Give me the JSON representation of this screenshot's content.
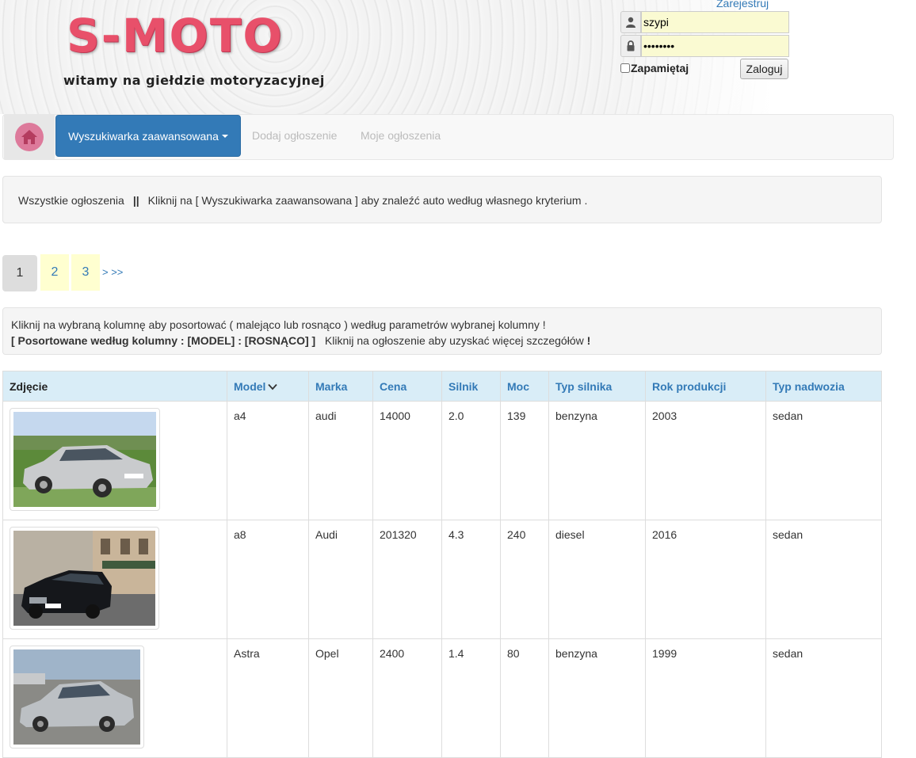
{
  "header": {
    "logo_title": "S-MOTO",
    "logo_subtitle": "witamy na giełdzie motoryzacyjnej",
    "register_link": "Zarejestruj",
    "username_value": "szypi",
    "password_value": "••••••••",
    "remember_label": "Zapamiętaj",
    "login_button": "Zaloguj"
  },
  "nav": {
    "home_icon": "home-icon",
    "search_dropdown": "Wyszukiwarka zaawansowana",
    "add_ad": "Dodaj ogłoszenie",
    "my_ads": "Moje ogłoszenia"
  },
  "info": {
    "all_ads": "Wszystkie ogłoszenia",
    "separator": "||",
    "hint": "Kliknij na [ Wyszukiwarka zaawansowana ] aby znaleźć auto według własnego kryterium ."
  },
  "pagination": {
    "current": "1",
    "pages": [
      "2",
      "3"
    ],
    "next": "> >>"
  },
  "sort_info": {
    "line1": "Kliknij na wybraną kolumnę aby posortować ( malejąco lub rosnąco ) według parametrów wybranej kolumny !",
    "sorted_label": "[ Posortowane według kolumny :  [MODEL] :  [ROSNĄCO] ]",
    "click_hint": "Kliknij na ogłoszenie aby uzyskać więcej szczegółów",
    "click_hint_end": "!"
  },
  "table": {
    "headers": [
      "Zdjęcie",
      "Model",
      "Marka",
      "Cena",
      "Silnik",
      "Moc",
      "Typ silnika",
      "Rok produkcji",
      "Typ nadwozia"
    ],
    "rows": [
      {
        "model": "a4",
        "brand": "audi",
        "price": "14000",
        "engine": "2.0",
        "power": "139",
        "fuel": "benzyna",
        "year": "2003",
        "body": "sedan"
      },
      {
        "model": "a8",
        "brand": "Audi",
        "price": "201320",
        "engine": "4.3",
        "power": "240",
        "fuel": "diesel",
        "year": "2016",
        "body": "sedan"
      },
      {
        "model": "Astra",
        "brand": "Opel",
        "price": "2400",
        "engine": "1.4",
        "power": "80",
        "fuel": "benzyna",
        "year": "1999",
        "body": "sedan"
      }
    ]
  },
  "colors": {
    "accent": "#337ab7",
    "logo": "#e8506a",
    "table_header_bg": "#d9edf7",
    "pagination_bg": "#ffffd0"
  }
}
